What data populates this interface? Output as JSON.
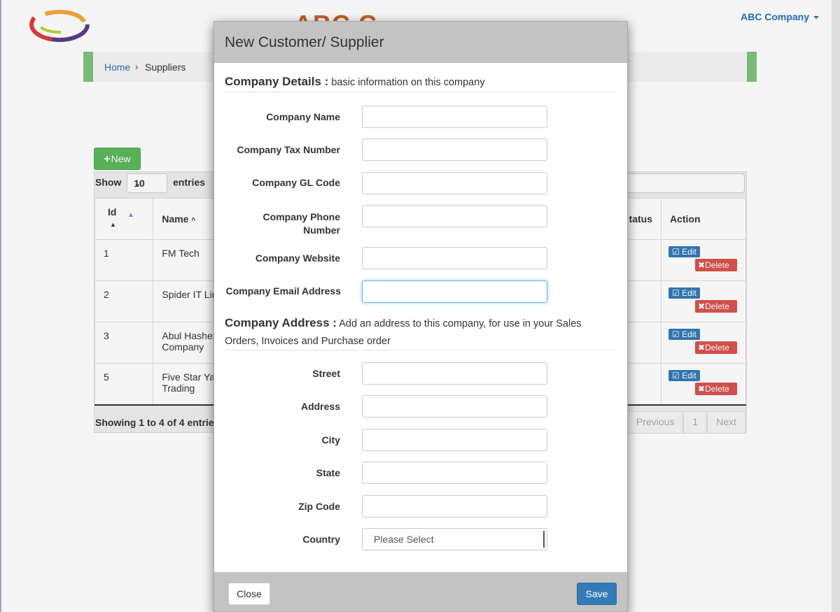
{
  "header": {
    "brand": "ABC C",
    "company_menu": "ABC Company"
  },
  "breadcrumb": {
    "home": "Home",
    "current": "Suppliers"
  },
  "toolbar": {
    "new_label": "New"
  },
  "table": {
    "show_label": "Show",
    "entries_value": "10",
    "entries_label": "entries",
    "columns": {
      "id": "Id",
      "name": "Name",
      "status": "tatus",
      "action": "Action"
    },
    "rows": [
      {
        "id": "1",
        "name": "FM Tech"
      },
      {
        "id": "2",
        "name": "Spider IT Limite"
      },
      {
        "id": "3",
        "name": "Abul Hashem Company"
      },
      {
        "id": "5",
        "name": "Five Star Yarn Trading"
      }
    ],
    "edit_label": "Edit",
    "delete_label": "Delete",
    "info": "Showing 1 to 4 of 4 entrie",
    "pagination": {
      "previous": "Previous",
      "page": "1",
      "next": "Next"
    }
  },
  "modal": {
    "title": "New Customer/ Supplier",
    "company_details": {
      "heading": "Company Details :",
      "desc": "basic information on this company"
    },
    "fields_details": [
      {
        "label": "Company Name",
        "value": ""
      },
      {
        "label": "Company Tax Number",
        "value": ""
      },
      {
        "label": "Company GL Code",
        "value": ""
      },
      {
        "label": "Company Phone Number",
        "value": ""
      },
      {
        "label": "Company Website",
        "value": ""
      },
      {
        "label": "Company Email Address",
        "value": ""
      }
    ],
    "company_address": {
      "heading": "Company Address :",
      "desc": "Add an address to this company, for use in your Sales Orders, Invoices and Purchase order"
    },
    "fields_address": [
      {
        "label": "Street",
        "value": ""
      },
      {
        "label": "Address",
        "value": ""
      },
      {
        "label": "City",
        "value": ""
      },
      {
        "label": "State",
        "value": ""
      },
      {
        "label": "Zip Code",
        "value": ""
      }
    ],
    "country": {
      "label": "Country",
      "selected": "Please Select"
    },
    "close_label": "Close",
    "save_label": "Save"
  }
}
